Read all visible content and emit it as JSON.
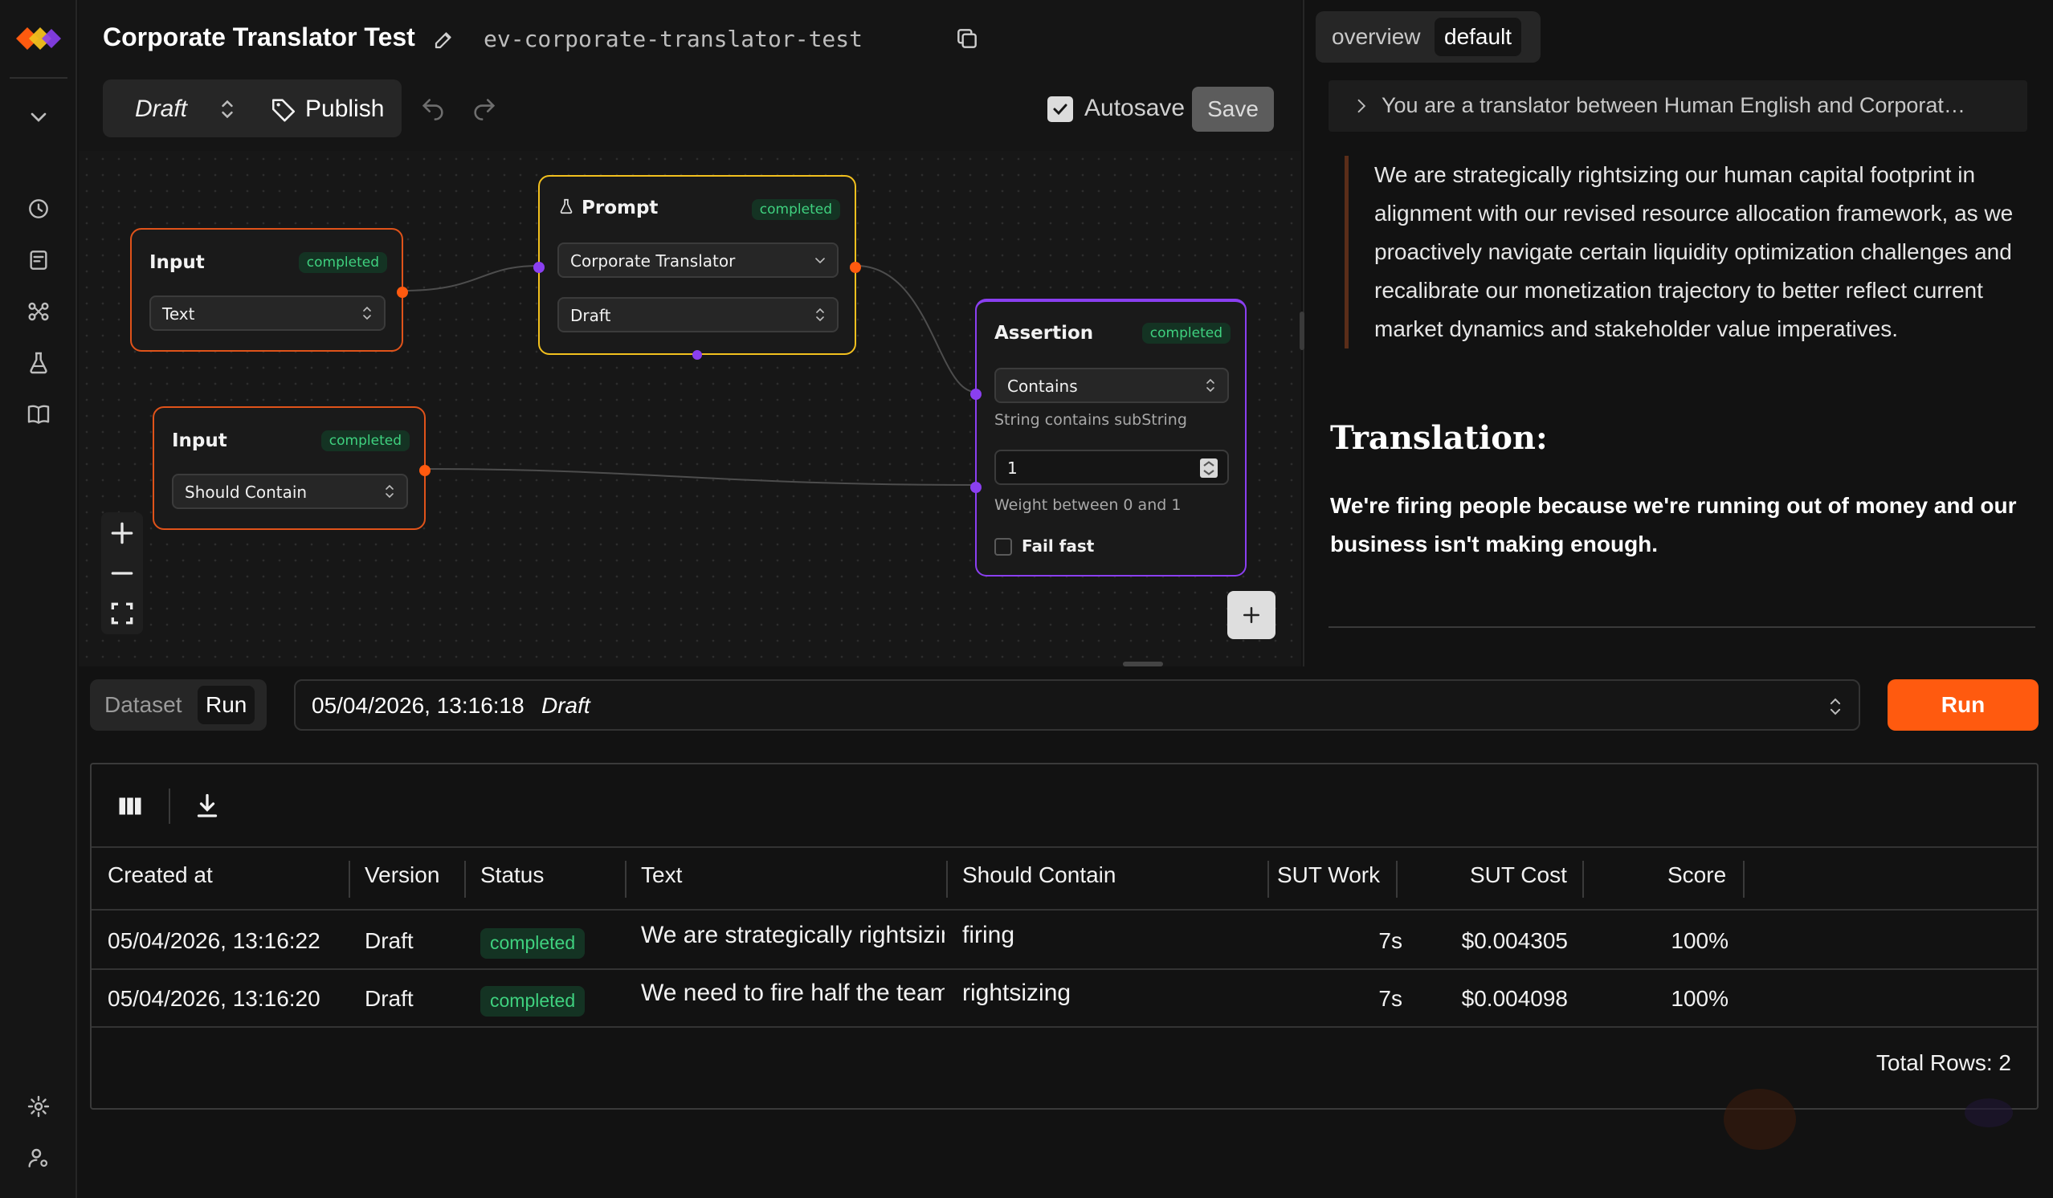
{
  "header": {
    "title": "Corporate Translator Test",
    "slug": "ev-corporate-translator-test",
    "version_label": "Draft",
    "publish_label": "Publish",
    "autosave_label": "Autosave",
    "autosave_checked": true,
    "save_label": "Save"
  },
  "nodes": {
    "input_text": {
      "title": "Input",
      "status": "completed",
      "field": "Text"
    },
    "input_should_contain": {
      "title": "Input",
      "status": "completed",
      "field": "Should Contain"
    },
    "prompt": {
      "title": "Prompt",
      "status": "completed",
      "prompt_select": "Corporate Translator",
      "version_select": "Draft"
    },
    "assertion": {
      "title": "Assertion",
      "status": "completed",
      "type_select": "Contains",
      "type_hint": "String contains subString",
      "weight_value": "1",
      "weight_hint": "Weight between 0 and 1",
      "fail_fast_label": "Fail fast",
      "fail_fast_checked": false
    }
  },
  "right_panel": {
    "tabs": [
      {
        "label": "overview",
        "active": false
      },
      {
        "label": "default",
        "active": true
      }
    ],
    "system_message": "You are a translator between Human English and Corporat…",
    "quote": "We are strategically rightsizing our human capital footprint in alignment with our revised resource allocation framework, as we proactively navigate certain liquidity optimization challenges and recalibrate our monetization trajectory to better reflect current market dynamics and stakeholder value imperatives.",
    "translation_heading": "Translation:",
    "translation_body": "We're firing people because we're running out of money and our business isn't making enough."
  },
  "run_bar": {
    "tabs": [
      {
        "label": "Dataset",
        "active": false
      },
      {
        "label": "Run",
        "active": true
      }
    ],
    "selected_run_date": "05/04/2026, 13:16:18",
    "selected_run_version": "Draft",
    "run_button": "Run"
  },
  "results": {
    "columns": [
      "Created at",
      "Version",
      "Status",
      "Text",
      "Should Contain",
      "SUT Work",
      "SUT Cost",
      "Score"
    ],
    "rows": [
      {
        "created_at": "05/04/2026, 13:16:22",
        "version": "Draft",
        "status": "completed",
        "text": "We are strategically rightsizing",
        "should_contain": "firing",
        "sut_work": "7s",
        "sut_cost": "$0.004305",
        "score": "100%"
      },
      {
        "created_at": "05/04/2026, 13:16:20",
        "version": "Draft",
        "status": "completed",
        "text": "We need to fire half the team",
        "should_contain": "rightsizing",
        "sut_work": "7s",
        "sut_cost": "$0.004098",
        "score": "100%"
      }
    ],
    "total_rows_label": "Total Rows: 2"
  },
  "colors": {
    "accent": "#ff5a0f",
    "input_node_border": "#e0531a",
    "prompt_node_border": "#f2c01e",
    "assertion_node_border": "#8a3ff0",
    "status_green": "#3fd17f"
  }
}
